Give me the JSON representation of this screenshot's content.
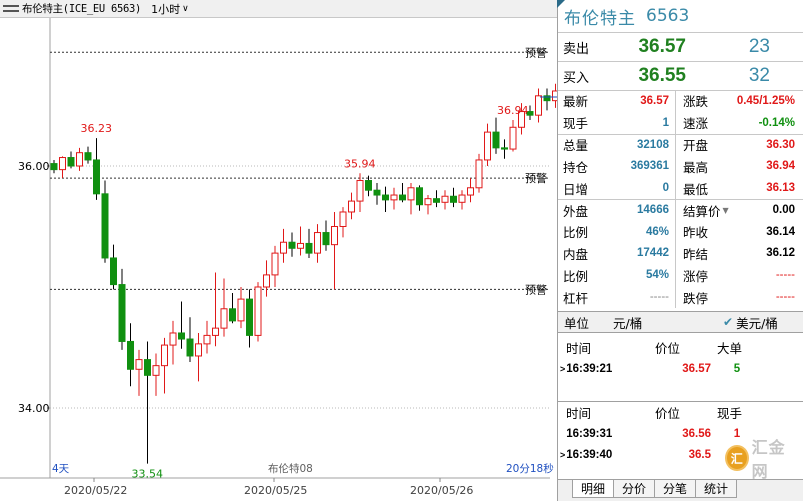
{
  "topbar": {
    "title": "布伦特主(ICE_EU 6563)",
    "period": "1小时"
  },
  "chart_data": {
    "type": "candlestick",
    "ylim": [
      33.45,
      36.98
    ],
    "y_ticks": [
      {
        "value": 34.0,
        "label": "34.00"
      },
      {
        "value": 36.0,
        "label": "36.00"
      }
    ],
    "x_ticks": [
      "2020/05/22",
      "2020/05/25",
      "2020/05/26"
    ],
    "warning_lines": [
      36.94,
      35.9,
      34.98
    ],
    "warning_label": "预警",
    "annotations": [
      {
        "index": 5,
        "label": "36.23",
        "at": "high"
      },
      {
        "index": 11,
        "label": "33.54",
        "at": "low"
      },
      {
        "index": 36,
        "label": "35.94",
        "at": "high"
      },
      {
        "index": 54,
        "label": "36.94",
        "at": "high"
      }
    ],
    "bottom_left_label": "4天",
    "bottom_center_label": "布伦特08",
    "bottom_right_label": "20分18秒",
    "candles": [
      {
        "o": 36.02,
        "h": 36.05,
        "l": 35.94,
        "c": 35.97
      },
      {
        "o": 35.97,
        "h": 36.08,
        "l": 35.9,
        "c": 36.07
      },
      {
        "o": 36.07,
        "h": 36.12,
        "l": 35.98,
        "c": 36.0
      },
      {
        "o": 36.0,
        "h": 36.15,
        "l": 35.96,
        "c": 36.11
      },
      {
        "o": 36.11,
        "h": 36.16,
        "l": 36.02,
        "c": 36.05
      },
      {
        "o": 36.05,
        "h": 36.23,
        "l": 35.72,
        "c": 35.77
      },
      {
        "o": 35.77,
        "h": 35.88,
        "l": 35.2,
        "c": 35.24
      },
      {
        "o": 35.24,
        "h": 35.35,
        "l": 34.98,
        "c": 35.02
      },
      {
        "o": 35.02,
        "h": 35.15,
        "l": 34.48,
        "c": 34.55
      },
      {
        "o": 34.55,
        "h": 34.7,
        "l": 34.18,
        "c": 34.32
      },
      {
        "o": 34.32,
        "h": 34.48,
        "l": 34.1,
        "c": 34.4
      },
      {
        "o": 34.4,
        "h": 34.55,
        "l": 33.54,
        "c": 34.27
      },
      {
        "o": 34.27,
        "h": 34.45,
        "l": 34.1,
        "c": 34.35
      },
      {
        "o": 34.35,
        "h": 34.58,
        "l": 34.12,
        "c": 34.52
      },
      {
        "o": 34.52,
        "h": 34.72,
        "l": 34.36,
        "c": 34.62
      },
      {
        "o": 34.62,
        "h": 34.88,
        "l": 34.49,
        "c": 34.57
      },
      {
        "o": 34.57,
        "h": 34.75,
        "l": 34.38,
        "c": 34.43
      },
      {
        "o": 34.43,
        "h": 34.62,
        "l": 34.22,
        "c": 34.53
      },
      {
        "o": 34.53,
        "h": 34.72,
        "l": 34.45,
        "c": 34.6
      },
      {
        "o": 34.6,
        "h": 35.12,
        "l": 34.51,
        "c": 34.66
      },
      {
        "o": 34.66,
        "h": 35.07,
        "l": 34.59,
        "c": 34.82
      },
      {
        "o": 34.82,
        "h": 34.95,
        "l": 34.7,
        "c": 34.72
      },
      {
        "o": 34.72,
        "h": 35.0,
        "l": 34.66,
        "c": 34.9
      },
      {
        "o": 34.9,
        "h": 34.98,
        "l": 34.5,
        "c": 34.6
      },
      {
        "o": 34.6,
        "h": 35.04,
        "l": 34.55,
        "c": 35.0
      },
      {
        "o": 35.0,
        "h": 35.22,
        "l": 34.92,
        "c": 35.1
      },
      {
        "o": 35.1,
        "h": 35.34,
        "l": 35.0,
        "c": 35.28
      },
      {
        "o": 35.28,
        "h": 35.48,
        "l": 35.2,
        "c": 35.37
      },
      {
        "o": 35.37,
        "h": 35.45,
        "l": 35.25,
        "c": 35.32
      },
      {
        "o": 35.32,
        "h": 35.5,
        "l": 35.26,
        "c": 35.36
      },
      {
        "o": 35.36,
        "h": 35.48,
        "l": 35.24,
        "c": 35.28
      },
      {
        "o": 35.28,
        "h": 35.52,
        "l": 35.2,
        "c": 35.45
      },
      {
        "o": 35.45,
        "h": 35.55,
        "l": 35.3,
        "c": 35.35
      },
      {
        "o": 35.35,
        "h": 35.62,
        "l": 34.98,
        "c": 35.5
      },
      {
        "o": 35.5,
        "h": 35.66,
        "l": 35.41,
        "c": 35.62
      },
      {
        "o": 35.62,
        "h": 35.78,
        "l": 35.56,
        "c": 35.71
      },
      {
        "o": 35.71,
        "h": 35.94,
        "l": 35.62,
        "c": 35.88
      },
      {
        "o": 35.88,
        "h": 35.92,
        "l": 35.75,
        "c": 35.8
      },
      {
        "o": 35.8,
        "h": 35.86,
        "l": 35.68,
        "c": 35.76
      },
      {
        "o": 35.76,
        "h": 35.83,
        "l": 35.62,
        "c": 35.72
      },
      {
        "o": 35.72,
        "h": 35.82,
        "l": 35.64,
        "c": 35.76
      },
      {
        "o": 35.76,
        "h": 35.86,
        "l": 35.7,
        "c": 35.72
      },
      {
        "o": 35.72,
        "h": 35.86,
        "l": 35.6,
        "c": 35.82
      },
      {
        "o": 35.82,
        "h": 35.84,
        "l": 35.63,
        "c": 35.68
      },
      {
        "o": 35.68,
        "h": 35.76,
        "l": 35.6,
        "c": 35.73
      },
      {
        "o": 35.73,
        "h": 35.8,
        "l": 35.66,
        "c": 35.7
      },
      {
        "o": 35.7,
        "h": 35.8,
        "l": 35.64,
        "c": 35.75
      },
      {
        "o": 35.75,
        "h": 35.82,
        "l": 35.66,
        "c": 35.7
      },
      {
        "o": 35.7,
        "h": 35.8,
        "l": 35.64,
        "c": 35.76
      },
      {
        "o": 35.76,
        "h": 35.9,
        "l": 35.7,
        "c": 35.82
      },
      {
        "o": 35.82,
        "h": 36.1,
        "l": 35.78,
        "c": 36.05
      },
      {
        "o": 36.05,
        "h": 36.35,
        "l": 36.0,
        "c": 36.28
      },
      {
        "o": 36.28,
        "h": 36.4,
        "l": 36.1,
        "c": 36.15
      },
      {
        "o": 36.15,
        "h": 36.22,
        "l": 36.06,
        "c": 36.14
      },
      {
        "o": 36.14,
        "h": 36.38,
        "l": 36.12,
        "c": 36.32
      },
      {
        "o": 36.32,
        "h": 36.52,
        "l": 36.26,
        "c": 36.45
      },
      {
        "o": 36.45,
        "h": 36.5,
        "l": 36.38,
        "c": 36.42
      },
      {
        "o": 36.42,
        "h": 36.64,
        "l": 36.36,
        "c": 36.58
      },
      {
        "o": 36.58,
        "h": 36.64,
        "l": 36.46,
        "c": 36.54
      },
      {
        "o": 36.54,
        "h": 36.68,
        "l": 36.48,
        "c": 36.62
      },
      {
        "o": 36.62,
        "h": 36.84,
        "l": 36.55,
        "c": 36.78
      },
      {
        "o": 36.78,
        "h": 36.89,
        "l": 36.6,
        "c": 36.74
      },
      {
        "o": 36.74,
        "h": 36.9,
        "l": 36.66,
        "c": 36.76
      },
      {
        "o": 36.76,
        "h": 36.94,
        "l": 36.62,
        "c": 36.8
      },
      {
        "o": 36.8,
        "h": 36.82,
        "l": 36.54,
        "c": 36.57
      }
    ]
  },
  "panel": {
    "symbol_name": "布伦特主",
    "symbol_code": "6563",
    "ask_label": "卖出",
    "ask_price": "36.57",
    "ask_vol": "23",
    "bid_label": "买入",
    "bid_price": "36.55",
    "bid_vol": "32",
    "quotes": [
      {
        "l1": "最新",
        "v1": "36.57",
        "l2": "涨跌",
        "v2": "0.45/1.25%"
      },
      {
        "l1": "现手",
        "v1": "1",
        "l2": "速涨",
        "v2": "-0.14%"
      },
      {
        "l1": "总量",
        "v1": "32108",
        "l2": "开盘",
        "v2": "36.30"
      },
      {
        "l1": "持仓",
        "v1": "369361",
        "l2": "最高",
        "v2": "36.94"
      },
      {
        "l1": "日增",
        "v1": "0",
        "l2": "最低",
        "v2": "36.13"
      },
      {
        "l1": "外盘",
        "v1": "14666",
        "l2": "结算价",
        "v2": "0.00"
      },
      {
        "l1": "比例",
        "v1": "46%",
        "l2": "昨收",
        "v2": "36.14"
      },
      {
        "l1": "内盘",
        "v1": "17442",
        "l2": "昨结",
        "v2": "36.12"
      },
      {
        "l1": "比例",
        "v1": "54%",
        "l2": "涨停",
        "v2": "-----"
      },
      {
        "l1": "杠杆",
        "v1": "-----",
        "l2": "跌停",
        "v2": "-----"
      }
    ],
    "unit_label": "单位",
    "unit_yuan": "元/桶",
    "unit_usd": "美元/桶",
    "ticks1": {
      "h1": "时间",
      "h2": "价位",
      "h3": "大单",
      "time": "16:39:21",
      "price": "36.57",
      "qty": "5"
    },
    "ticks2": {
      "h1": "时间",
      "h2": "价位",
      "h3": "现手",
      "rows": [
        {
          "time": "16:39:31",
          "price": "36.56",
          "qty": "1"
        },
        {
          "time": "16:39:40",
          "price": "36.5",
          "qty": ""
        }
      ]
    },
    "tabs": [
      "明细",
      "分价",
      "分笔",
      "统计"
    ],
    "watermark_logo": "汇",
    "watermark_text": "汇金网"
  },
  "colors": {
    "up": "#e01818",
    "down": "#109010",
    "accent": "#3a8aa8"
  }
}
